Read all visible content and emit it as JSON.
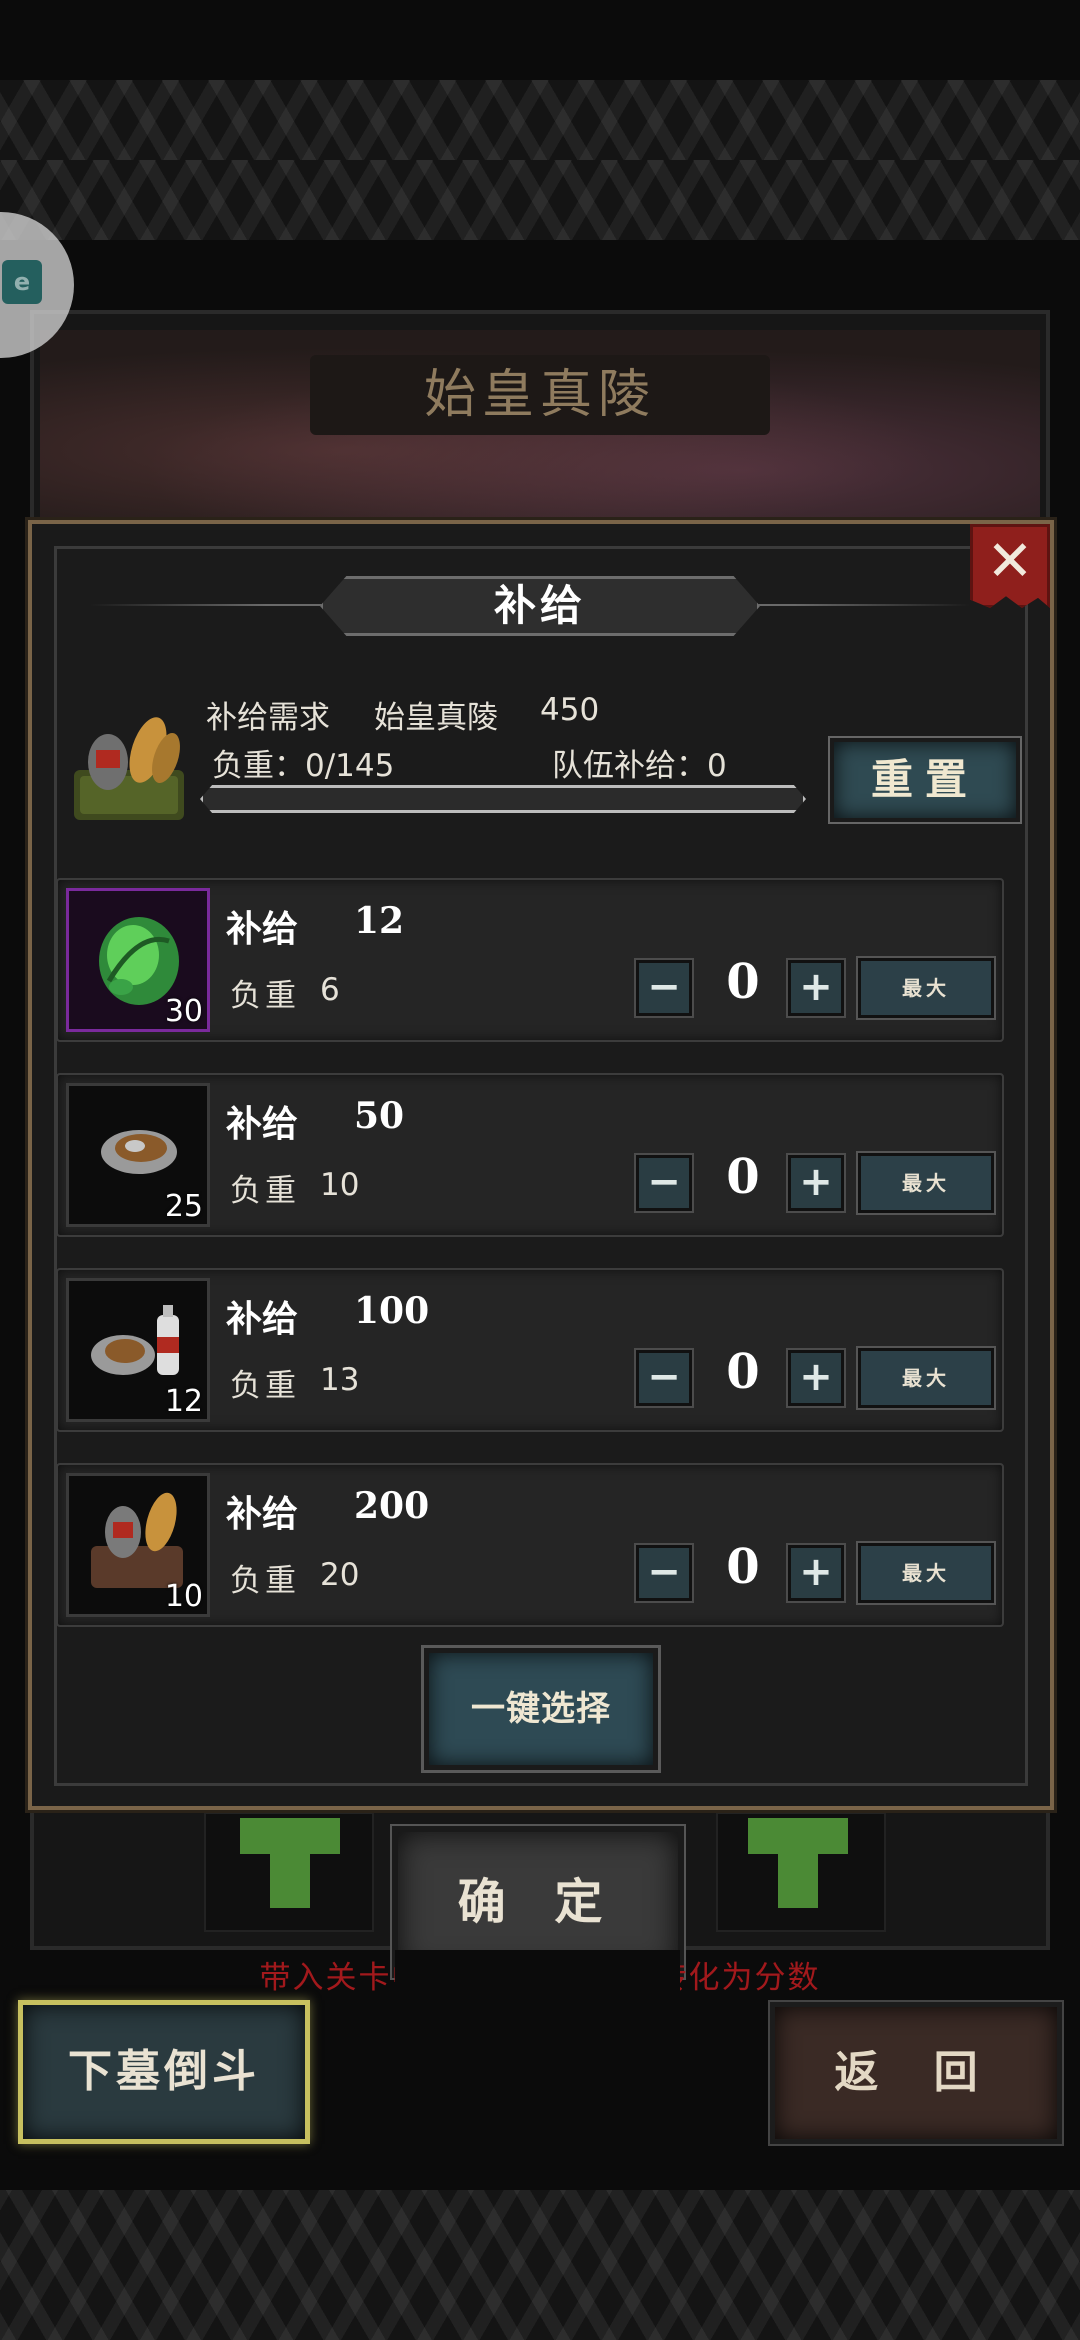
{
  "background": {
    "title": "始皇真陵",
    "confirm_label": "确 定",
    "hint": "带入关卡中未使用的补给将转化为分数",
    "descend_label": "下墓倒斗",
    "return_label": "返 回"
  },
  "modal": {
    "title": "补给",
    "summary": {
      "demand_label": "补给需求",
      "tomb_name": "始皇真陵",
      "demand_value": "450",
      "weight_text": "负重：0/145",
      "team_supply_text": "队伍补给：0",
      "weight_fraction": 0
    },
    "reset_label": "重置",
    "rows": [
      {
        "label": "补给",
        "value": "12",
        "weight_label": "负重",
        "weight": "6",
        "qty": "30",
        "count": "0",
        "max_label": "最大",
        "rarity": "purple"
      },
      {
        "label": "补给",
        "value": "50",
        "weight_label": "负重",
        "weight": "10",
        "qty": "25",
        "count": "0",
        "max_label": "最大",
        "rarity": "normal"
      },
      {
        "label": "补给",
        "value": "100",
        "weight_label": "负重",
        "weight": "13",
        "qty": "12",
        "count": "0",
        "max_label": "最大",
        "rarity": "normal"
      },
      {
        "label": "补给",
        "value": "200",
        "weight_label": "负重",
        "weight": "20",
        "qty": "10",
        "count": "0",
        "max_label": "最大",
        "rarity": "normal"
      }
    ],
    "one_key_label": "一键选择",
    "minus_symbol": "−",
    "plus_symbol": "+",
    "close_symbol": "✕"
  },
  "colors": {
    "frame_gold": "#7a6448",
    "close_red": "#8f1f1c",
    "hint_red": "#a2191c",
    "highlight_yellow": "#c7c05f",
    "rare_purple": "#7a2a9c"
  },
  "icons": [
    "supply-bundle-icon",
    "green-leaf-pack-icon",
    "bread-pack-icon",
    "bread-and-bottle-icon",
    "lantern-and-bread-icon"
  ]
}
